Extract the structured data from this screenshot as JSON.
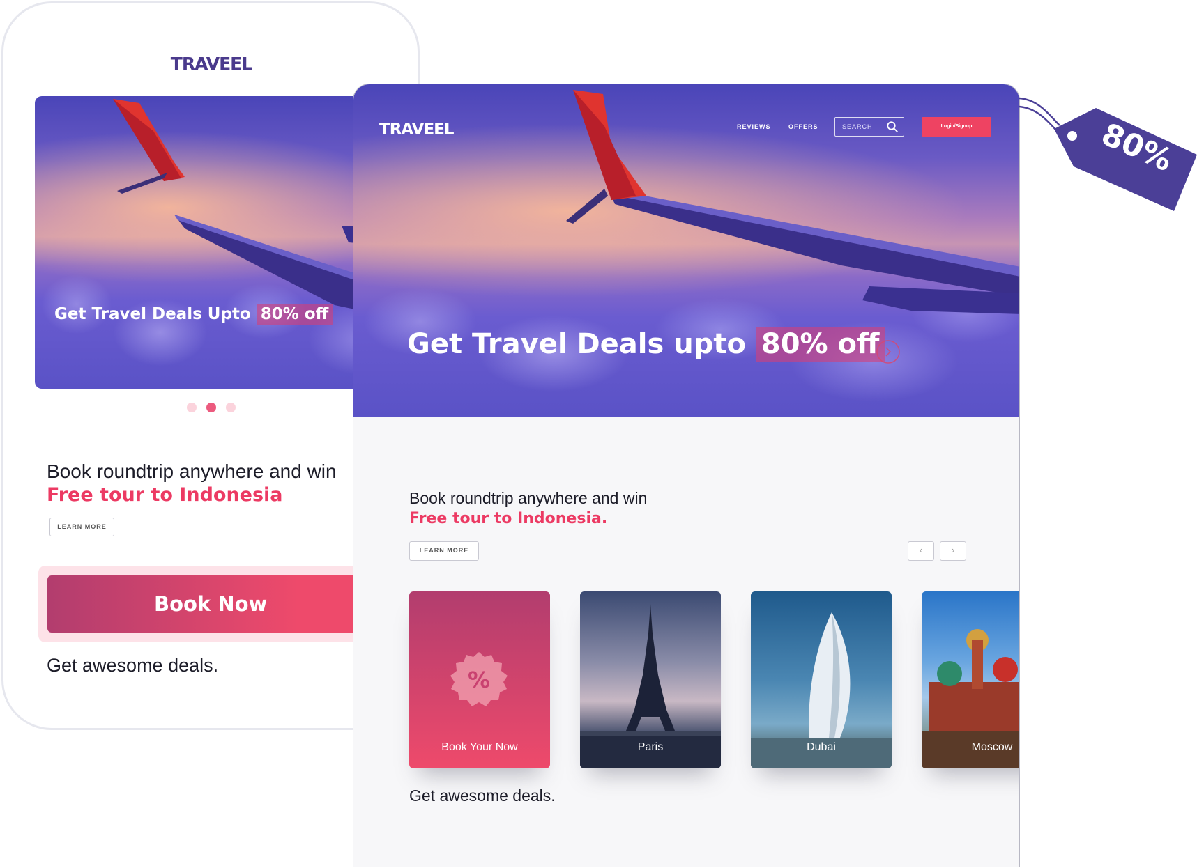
{
  "mobile": {
    "logo": "TRAVEEL",
    "hero": {
      "title": "Get Travel Deals Upto ",
      "highlight": "80% off"
    },
    "carousel": {
      "count": 3,
      "active_index": 1
    },
    "promo": {
      "line1": "Book roundtrip anywhere and win",
      "highlight": "Free tour to Indonesia"
    },
    "learn_more": "LEARN MORE",
    "book_button": "Book Now",
    "deals_text": "Get awesome deals."
  },
  "desktop": {
    "logo": "TRAVEEL",
    "nav": {
      "reviews": "REVIEWS",
      "offers": "OFFERS"
    },
    "search": {
      "placeholder": "SEARCH"
    },
    "login": "Login/Signup",
    "hero": {
      "title": "Get Travel Deals upto ",
      "highlight": "80% off"
    },
    "promo": {
      "line1": "Book roundtrip anywhere and win",
      "highlight": "Free tour to Indonesia."
    },
    "learn_more": "LEARN MORE",
    "pager": {
      "prev": "‹",
      "next": "›"
    },
    "cards": [
      {
        "label": "Book Your Now",
        "icon": "percent-badge-icon"
      },
      {
        "label": "Paris"
      },
      {
        "label": "Dubai"
      },
      {
        "label": "Moscow"
      }
    ],
    "deals_text": "Get awesome deals."
  },
  "tag": {
    "text": "80%"
  },
  "colors": {
    "brand_purple": "#4a3a8c",
    "accent_pink": "#ec3a63",
    "tag_purple": "#4b3f97"
  }
}
